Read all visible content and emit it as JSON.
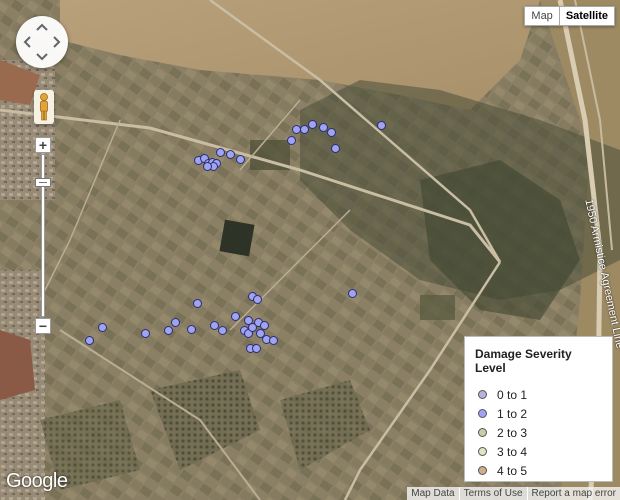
{
  "map_type": {
    "map_label": "Map",
    "satellite_label": "Satellite",
    "active": "Satellite"
  },
  "road_label": "1950 Armistice Agreement Line",
  "logo": "Google",
  "footer": {
    "map_data": "Map Data",
    "terms": "Terms of Use",
    "report": "Report a map error"
  },
  "legend": {
    "title": "Damage Severity Level",
    "items": [
      {
        "label": "0 to 1",
        "color": "#b7b3e0"
      },
      {
        "label": "1 to 2",
        "color": "#9fa3f2"
      },
      {
        "label": "2 to 3",
        "color": "#c7cfa6"
      },
      {
        "label": "3 to 4",
        "color": "#e3e2c2"
      },
      {
        "label": "4 to 5",
        "color": "#d2ad8b"
      }
    ]
  },
  "marker_color": "#9fa3f2"
}
